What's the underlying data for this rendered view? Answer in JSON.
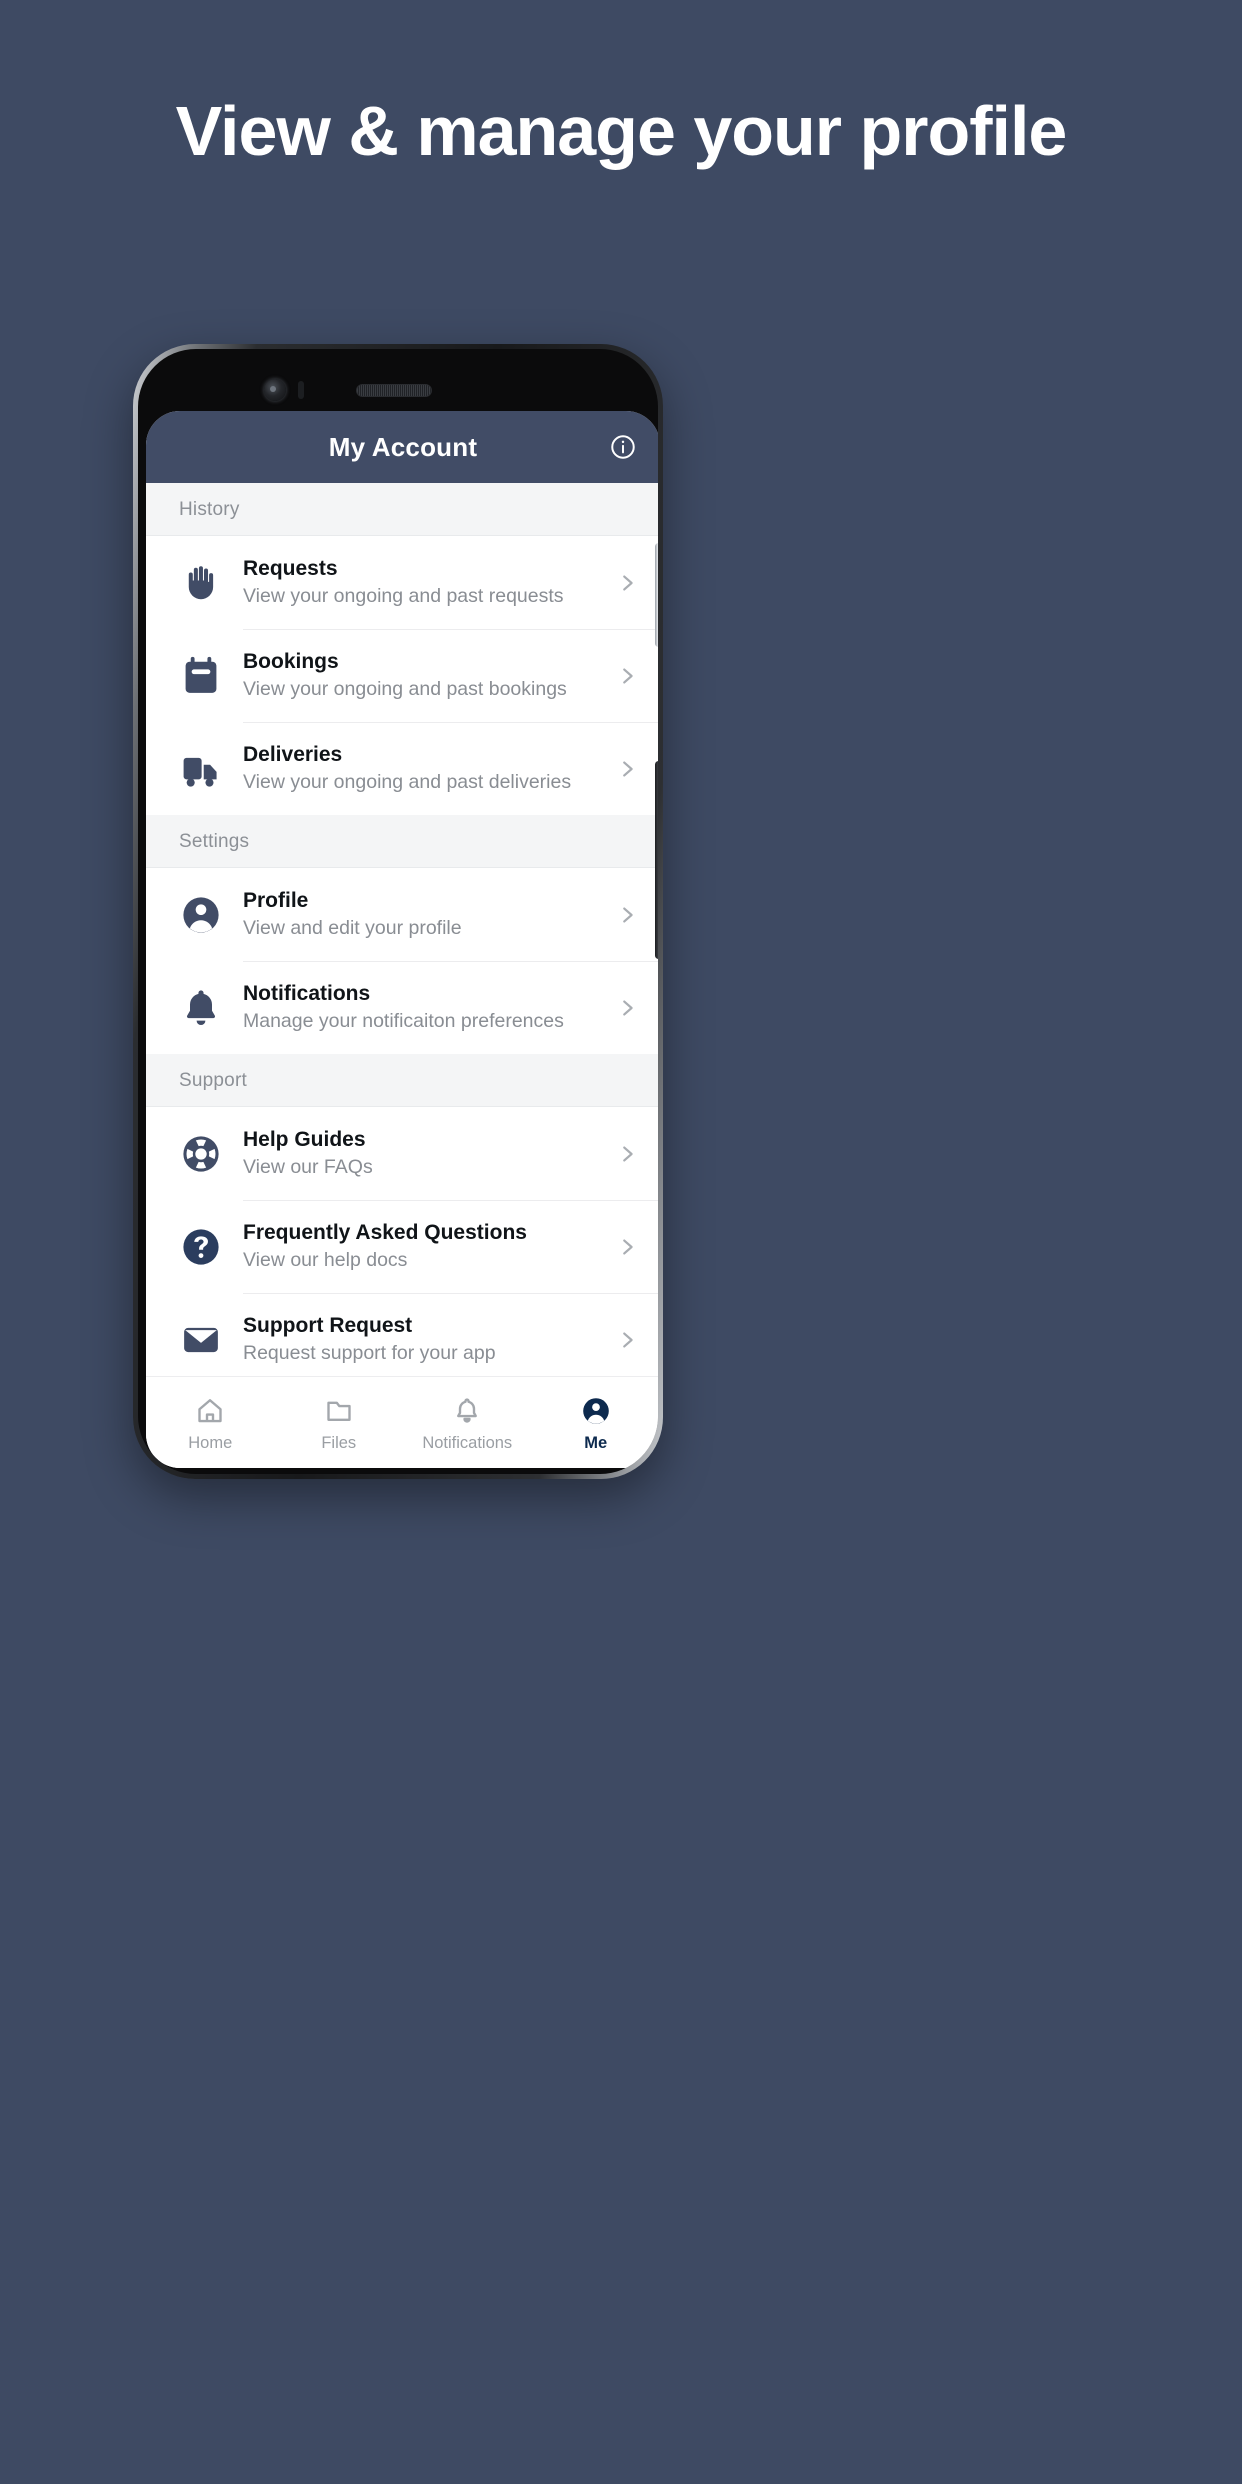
{
  "promo": {
    "headline": "View & manage your profile",
    "background_color": "#3e4a63"
  },
  "app": {
    "header": {
      "title": "My Account",
      "background_color": "#414c66",
      "info_icon": "info-circle-icon"
    },
    "accent_color": "#414c66",
    "sections": [
      {
        "label": "History",
        "rows": [
          {
            "icon": "hand-raised-icon",
            "title": "Requests",
            "subtitle": "View your ongoing and past requests",
            "chevron": "chevron-right-icon"
          },
          {
            "icon": "calendar-icon",
            "title": "Bookings",
            "subtitle": "View your ongoing and past bookings",
            "chevron": "chevron-right-icon"
          },
          {
            "icon": "truck-icon",
            "title": "Deliveries",
            "subtitle": "View your ongoing and past deliveries",
            "chevron": "chevron-right-icon"
          }
        ]
      },
      {
        "label": "Settings",
        "rows": [
          {
            "icon": "user-circle-icon",
            "title": "Profile",
            "subtitle": "View and edit your profile",
            "chevron": "chevron-right-icon"
          },
          {
            "icon": "bell-icon",
            "title": "Notifications",
            "subtitle": "Manage your notificaiton preferences",
            "chevron": "chevron-right-icon"
          }
        ]
      },
      {
        "label": "Support",
        "rows": [
          {
            "icon": "life-ring-icon",
            "title": "Help Guides",
            "subtitle": "View our FAQs",
            "chevron": "chevron-right-icon"
          },
          {
            "icon": "question-circle-icon",
            "title": "Frequently Asked Questions",
            "subtitle": "View our help docs",
            "chevron": "chevron-right-icon"
          },
          {
            "icon": "envelope-icon",
            "title": "Support Request",
            "subtitle": "Request support for your app",
            "chevron": "chevron-right-icon"
          }
        ]
      }
    ],
    "tabs": [
      {
        "label": "Home",
        "icon": "home-icon",
        "active": false
      },
      {
        "label": "Files",
        "icon": "folder-icon",
        "active": false
      },
      {
        "label": "Notifications",
        "icon": "bell-icon",
        "active": false
      },
      {
        "label": "Me",
        "icon": "user-circle-icon",
        "active": true
      }
    ]
  }
}
